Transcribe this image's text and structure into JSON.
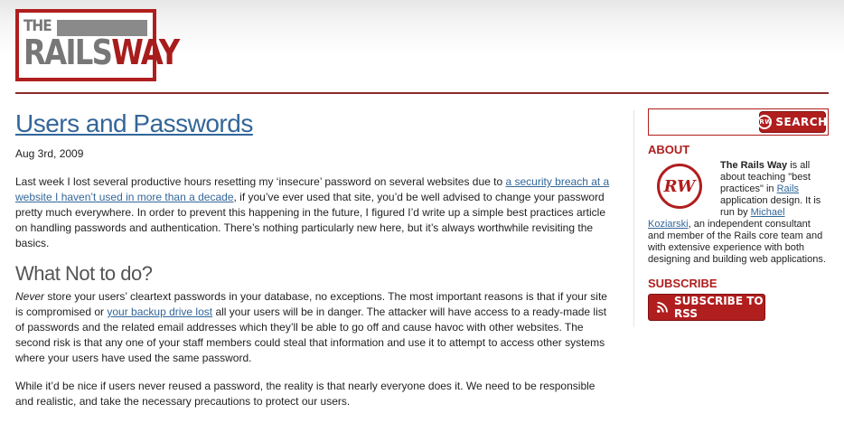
{
  "logo": {
    "the": "THE",
    "rails": "RAILS",
    "way": "WAY"
  },
  "post": {
    "title": "Users and Passwords",
    "date": "Aug 3rd, 2009",
    "intro_before": "Last week I lost several productive hours resetting my ‘insecure’ password on several websites due to ",
    "intro_link": "a security breach at a website I haven’t used in more than a decade",
    "intro_after": ", if you’ve ever used that site, you’d be well advised to change your password pretty much everywhere. In order to prevent this happening in the future, I figured I’d write up a simple best practices article on handling passwords and authentication. There’s nothing particularly new here, but it’s always worthwhile revisiting the basics.",
    "h2": "What Not to do?",
    "p2_em": "Never",
    "p2_before": " store your users’ cleartext passwords in your database, no exceptions. The most important reasons is that if your site is compromised or ",
    "p2_link": "your backup drive lost",
    "p2_after": " all your users will be in danger. The attacker will have access to a ready-made list of passwords and the related email addresses which they’ll be able to go off and cause havoc with other websites. The second risk is that any one of your staff members could steal that information and use it to attempt to access other systems where your users have used the same password.",
    "p3": "While it’d be nice if users never reused a password, the reality is that nearly everyone does it. We need to be responsible and realistic, and take the necessary precautions to protect our users."
  },
  "sidebar": {
    "search": {
      "placeholder": "",
      "button_label": "Search",
      "button_icon_text": "RW"
    },
    "about_heading": "ABOUT",
    "about_logo_text": "RW",
    "about": {
      "strong": "The Rails Way",
      "t1": " is all about teaching \"best practices\" in ",
      "link1": "Rails",
      "t2": " application design. It is run by ",
      "link2": "Michael Koziarski",
      "t3": ", an independent consultant and member of the Rails core team and with extensive experience with both designing and building web applications."
    },
    "subscribe_heading": "SUBSCRIBE",
    "subscribe_button": "Subscribe to RSS"
  },
  "colors": {
    "brand": "#b01e1e",
    "link": "#336699"
  }
}
